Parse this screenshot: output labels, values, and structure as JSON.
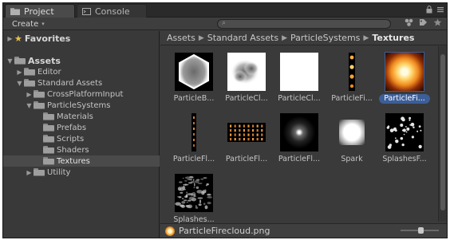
{
  "tabs": [
    {
      "label": "Project",
      "icon": "folder-icon"
    },
    {
      "label": "Console",
      "icon": "console-icon"
    }
  ],
  "toolbar": {
    "create_label": "Create"
  },
  "search": {
    "placeholder": ""
  },
  "tree": [
    {
      "label": "Favorites",
      "icon": "star-icon",
      "expanded": false
    },
    {
      "label": "Assets",
      "expanded": true
    },
    {
      "label": "Editor",
      "expanded": false
    },
    {
      "label": "Standard Assets",
      "expanded": true
    },
    {
      "label": "CrossPlatformInput",
      "expanded": false
    },
    {
      "label": "ParticleSystems",
      "expanded": true
    },
    {
      "label": "Materials"
    },
    {
      "label": "Prefabs"
    },
    {
      "label": "Scripts"
    },
    {
      "label": "Shaders"
    },
    {
      "label": "Textures",
      "selected": true
    },
    {
      "label": "Utility",
      "expanded": false
    }
  ],
  "breadcrumb": [
    "Assets",
    "Standard Assets",
    "ParticleSystems",
    "Textures"
  ],
  "assets": [
    {
      "label": "ParticleB...",
      "kind": "hexagon"
    },
    {
      "label": "ParticleCl...",
      "kind": "cloud"
    },
    {
      "label": "ParticleCl...",
      "kind": "white-square"
    },
    {
      "label": "ParticleFi...",
      "kind": "fire-column"
    },
    {
      "label": "ParticleFi...",
      "kind": "fire-cloud",
      "selected": true
    },
    {
      "label": "ParticleFl...",
      "kind": "flame-strip"
    },
    {
      "label": "ParticleFl...",
      "kind": "flame-grid"
    },
    {
      "label": "ParticleFl...",
      "kind": "flare"
    },
    {
      "label": "Spark",
      "kind": "spark"
    },
    {
      "label": "SplashesF...",
      "kind": "splashes-dots"
    },
    {
      "label": "Splashes...",
      "kind": "splashes-noise"
    }
  ],
  "status": {
    "filename": "ParticleFirecloud.png"
  },
  "colors": {
    "selection": "#3c5e99",
    "panel": "#3a3a3a"
  }
}
